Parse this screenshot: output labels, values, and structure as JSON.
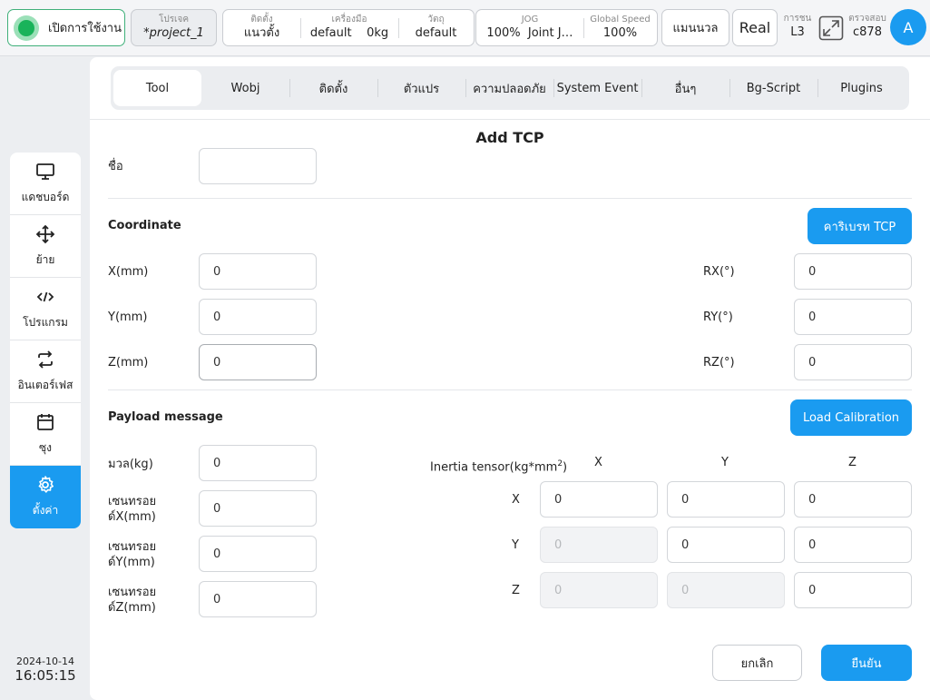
{
  "topbar": {
    "enable_label": "เปิดการใช้งาน",
    "project": {
      "label": "โปรเจค",
      "value": "*project_1"
    },
    "install": {
      "label": "ติดตั้ง",
      "value": "แนวตั้ง"
    },
    "tool": {
      "label": "เครื่องมือ",
      "value": "default",
      "weight": "0kg"
    },
    "object": {
      "label": "วัตถุ",
      "value": "default"
    },
    "jog": {
      "label": "JOG",
      "value": "100%",
      "mode": "Joint J…"
    },
    "speed": {
      "label": "Global Speed",
      "value": "100%"
    },
    "manual_label": "แมนนวล",
    "real_label": "Real",
    "collision": {
      "label": "การชน",
      "value": "L3"
    },
    "check": {
      "label": "ตรวจสอบ",
      "value": "c878"
    },
    "avatar": "A"
  },
  "sidebar": {
    "items": [
      {
        "label": "แดชบอร์ด",
        "icon": "monitor-icon"
      },
      {
        "label": "ย้าย",
        "icon": "move-icon"
      },
      {
        "label": "โปรแกรม",
        "icon": "code-icon"
      },
      {
        "label": "อินเตอร์เฟส",
        "icon": "swap-icon"
      },
      {
        "label": "ซุง",
        "icon": "calendar-icon"
      },
      {
        "label": "ตั้งค่า",
        "icon": "gear-icon",
        "active": true
      }
    ],
    "date": "2024-10-14",
    "time": "16:05:15"
  },
  "tabs": [
    "Tool",
    "Wobj",
    "ติดตั้ง",
    "ตัวแปร",
    "ความปลอดภัย",
    "System Event",
    "อื่นๆ",
    "Bg-Script",
    "Plugins"
  ],
  "active_tab": "Tool",
  "form": {
    "title": "Add TCP",
    "name_label": "ชื่อ",
    "name_value": "",
    "coordinate_title": "Coordinate",
    "calibrate_button": "คาริเบรท TCP",
    "x_label": "X(mm)",
    "x_value": "0",
    "y_label": "Y(mm)",
    "y_value": "0",
    "z_label": "Z(mm)",
    "z_value": "0",
    "rx_label": "RX(°)",
    "rx_value": "0",
    "ry_label": "RY(°)",
    "ry_value": "0",
    "rz_label": "RZ(°)",
    "rz_value": "0",
    "payload_title": "Payload message",
    "load_calibration_button": "Load Calibration",
    "mass_label": "มวล(kg)",
    "mass_value": "0",
    "cx_label_1": "เซนทรอย",
    "cx_label_2": "ด์X(mm)",
    "cx_value": "0",
    "cy_label_1": "เซนทรอย",
    "cy_label_2": "ด์Y(mm)",
    "cy_value": "0",
    "cz_label_1": "เซนทรอย",
    "cz_label_2": "ด์Z(mm)",
    "cz_value": "0",
    "inertia_label": "Inertia tensor(kg*mm",
    "inertia_sup": "2",
    "inertia_close": ")",
    "col_x": "X",
    "col_y": "Y",
    "col_z": "Z",
    "row_x": "X",
    "row_y": "Y",
    "row_z": "Z",
    "inertia": {
      "xx": "0",
      "xy": "0",
      "xz": "0",
      "yx": "0",
      "yy": "0",
      "yz": "0",
      "zx": "0",
      "zy": "0",
      "zz": "0"
    },
    "cancel_button": "ยกเลิก",
    "confirm_button": "ยืนยัน"
  },
  "colors": {
    "accent": "#1a9bf0",
    "enable_green": "#19b35a"
  }
}
